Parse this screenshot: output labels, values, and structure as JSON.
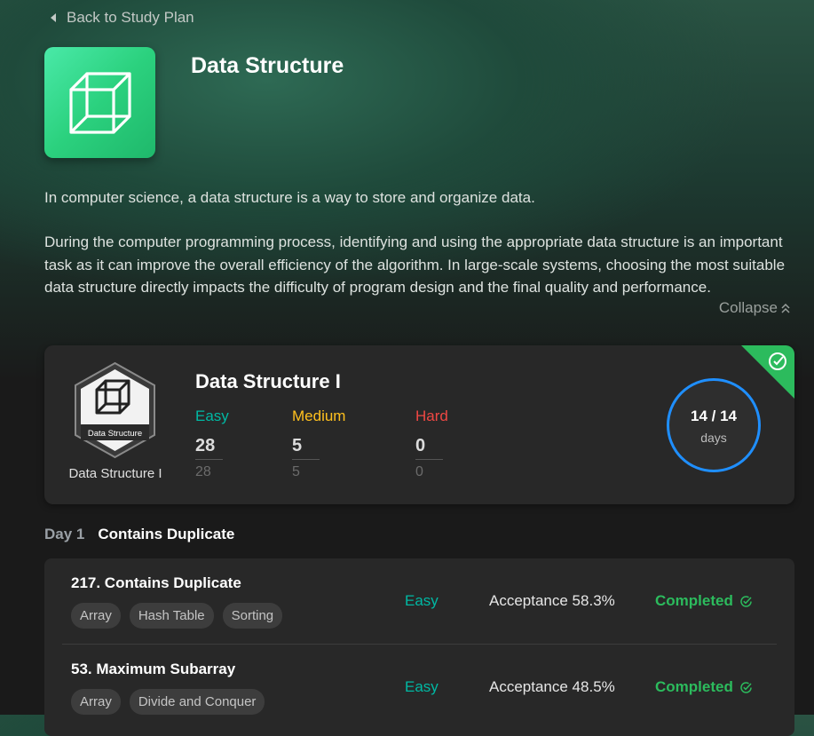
{
  "nav": {
    "back_label": "Back to Study Plan"
  },
  "plan": {
    "title": "Data Structure",
    "icon": "cube-icon",
    "description": [
      "In computer science, a data structure is a way to store and organize data.",
      "During the computer programming process, identifying and using the appropriate data structure is an important task as it can improve the overall efficiency of the algorithm. In large-scale systems, choosing the most suitable data structure directly impacts the difficulty of program design and the final quality and performance."
    ],
    "collapse_label": "Collapse"
  },
  "card": {
    "title": "Data Structure I",
    "badge_text": "Data Structure",
    "badge_label": "Data Structure I",
    "completed_icon": "check-circle-icon",
    "stats": [
      {
        "label": "Easy",
        "value": "28",
        "total": "28",
        "color": "#00b8a3"
      },
      {
        "label": "Medium",
        "value": "5",
        "total": "5",
        "color": "#ffc01e"
      },
      {
        "label": "Hard",
        "value": "0",
        "total": "0",
        "color": "#ef4743"
      }
    ],
    "progress": {
      "text": "14 / 14",
      "unit": "days",
      "fraction": 1.0
    }
  },
  "day": {
    "label": "Day 1",
    "title": "Contains Duplicate"
  },
  "problems": [
    {
      "title": "217. Contains Duplicate",
      "tags": [
        "Array",
        "Hash Table",
        "Sorting"
      ],
      "difficulty": "Easy",
      "acceptance": "Acceptance 58.3%",
      "status": "Completed"
    },
    {
      "title": "53. Maximum Subarray",
      "tags": [
        "Array",
        "Divide and Conquer"
      ],
      "difficulty": "Easy",
      "acceptance": "Acceptance 48.5%",
      "status": "Completed"
    }
  ],
  "colors": {
    "accent_green": "#2cbb5d",
    "easy": "#00b8a3",
    "medium": "#ffc01e",
    "hard": "#ef4743",
    "ring_blue": "#1f8fff"
  }
}
